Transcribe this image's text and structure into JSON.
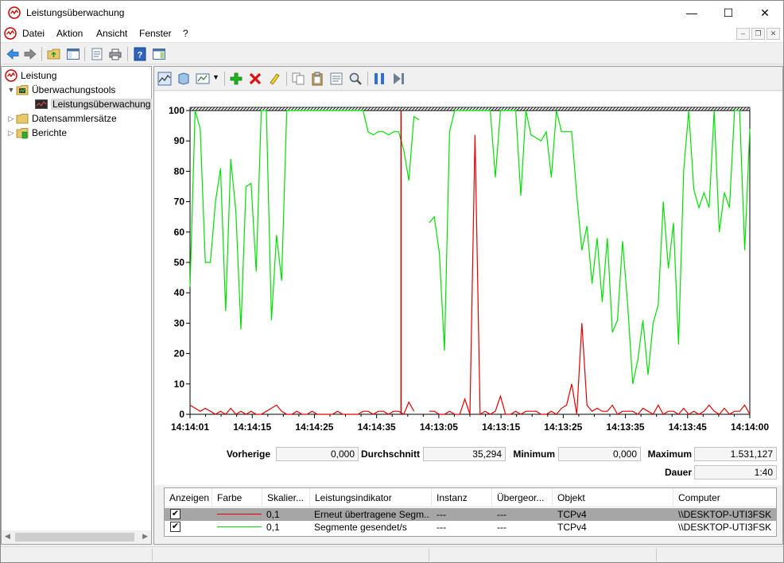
{
  "window": {
    "title": "Leistungsüberwachung",
    "minimize": "—",
    "maximize": "☐",
    "close": "✕"
  },
  "menu": {
    "items": [
      "Datei",
      "Aktion",
      "Ansicht",
      "Fenster",
      "?"
    ]
  },
  "tree": {
    "root": "Leistung",
    "monitoring_tools": "Überwachungstools",
    "performance_monitor": "Leistungsüberwachung",
    "data_collector_sets": "Datensammlersätze",
    "reports": "Berichte"
  },
  "stats": {
    "previous_label": "Vorherige",
    "previous_value": "0,000",
    "average_label": "Durchschnitt",
    "average_value": "35,294",
    "minimum_label": "Minimum",
    "minimum_value": "0,000",
    "maximum_label": "Maximum",
    "maximum_value": "1.531,127",
    "duration_label": "Dauer",
    "duration_value": "1:40"
  },
  "table": {
    "headers": [
      "Anzeigen",
      "Farbe",
      "Skalier...",
      "Leistungsindikator",
      "Instanz",
      "Übergeor...",
      "Objekt",
      "Computer"
    ],
    "rows": [
      {
        "show": "✔",
        "color": "#e00000",
        "scale": "0,1",
        "counter": "Erneut übertragene Segm...",
        "instance": "---",
        "parent": "---",
        "object": "TCPv4",
        "computer": "\\\\DESKTOP-UTI3FSK"
      },
      {
        "show": "✔",
        "color": "#00e000",
        "scale": "0,1",
        "counter": "Segmente gesendet/s",
        "instance": "---",
        "parent": "---",
        "object": "TCPv4",
        "computer": "\\\\DESKTOP-UTI3FSK"
      }
    ]
  },
  "chart_data": {
    "type": "line",
    "ylim": [
      0,
      100
    ],
    "yticks": [
      0,
      10,
      20,
      30,
      40,
      50,
      60,
      70,
      80,
      90,
      100
    ],
    "xticks": [
      "14:14:01",
      "14:14:15",
      "14:14:25",
      "14:14:35",
      "14:13:05",
      "14:13:15",
      "14:13:25",
      "14:13:35",
      "14:13:45",
      "14:14:00"
    ],
    "colors": {
      "red": "#e00000",
      "green": "#00e000",
      "current_marker": "#c00000"
    },
    "current_position": 0.377,
    "series": [
      {
        "name": "Segmente gesendet/s",
        "values": [
          42,
          100,
          94,
          50,
          50,
          70,
          81,
          34,
          84,
          67,
          28,
          75,
          76,
          47,
          100,
          100,
          31,
          59,
          44,
          100,
          100,
          100,
          100,
          100,
          100,
          100,
          100,
          100,
          100,
          100,
          100,
          100,
          100,
          100,
          100,
          93,
          92,
          93,
          93,
          92,
          93,
          93,
          87,
          77,
          98,
          97,
          null,
          63,
          65,
          53,
          21,
          93,
          100,
          100,
          100,
          100,
          100,
          100,
          100,
          100,
          78,
          100,
          100,
          100,
          100,
          72,
          100,
          92,
          91,
          90,
          93,
          78,
          100,
          93,
          93,
          93,
          72,
          54,
          62,
          43,
          58,
          37,
          58,
          27,
          31,
          57,
          36,
          10,
          18,
          31,
          13,
          30,
          36,
          70,
          48,
          63,
          23,
          80,
          100,
          74,
          68,
          73,
          68,
          100,
          60,
          73,
          68,
          100,
          100,
          54,
          94
        ]
      },
      {
        "name": "Erneut übertragene Segm...",
        "values": [
          3,
          2,
          1,
          2,
          1,
          0,
          1,
          0,
          2,
          0,
          1,
          0,
          1,
          0,
          0,
          1,
          2,
          3,
          1,
          0,
          0,
          1,
          0,
          0,
          1,
          0,
          0,
          0,
          0,
          1,
          0,
          0,
          0,
          0,
          1,
          1,
          0,
          1,
          1,
          0,
          1,
          1,
          0,
          4,
          1,
          null,
          null,
          1,
          1,
          0,
          0,
          1,
          0,
          0,
          5,
          0,
          92,
          0,
          1,
          0,
          1,
          6,
          0,
          0,
          1,
          0,
          1,
          1,
          1,
          0,
          0,
          1,
          0,
          2,
          3,
          10,
          0,
          30,
          3,
          1,
          2,
          1,
          1,
          3,
          0,
          1,
          1,
          1,
          0,
          2,
          1,
          0,
          3,
          0,
          1,
          1,
          0,
          2,
          0,
          1,
          0,
          1,
          3,
          1,
          0,
          2,
          0,
          1,
          1,
          3,
          0
        ]
      }
    ]
  }
}
